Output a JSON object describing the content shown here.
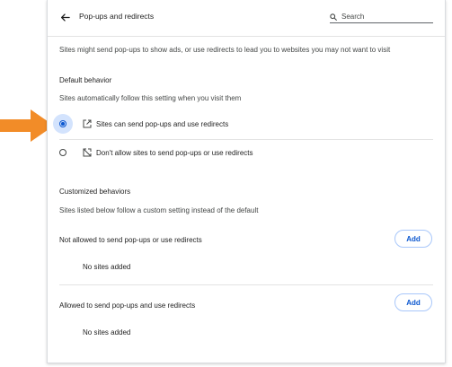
{
  "header": {
    "title": "Pop-ups and redirects",
    "search_placeholder": "Search"
  },
  "intro_text": "Sites might send pop-ups to show ads, or use redirects to lead you to websites you may not want to visit",
  "default_behavior": {
    "title": "Default behavior",
    "subtitle": "Sites automatically follow this setting when you visit them",
    "options": [
      {
        "label": "Sites can send pop-ups and use redirects",
        "selected": true,
        "icon": "open-in-new-icon"
      },
      {
        "label": "Don't allow sites to send pop-ups or use redirects",
        "selected": false,
        "icon": "popup-blocked-icon"
      }
    ]
  },
  "customized_behaviors": {
    "title": "Customized behaviors",
    "subtitle": "Sites listed below follow a custom setting instead of the default",
    "not_allowed": {
      "label": "Not allowed to send pop-ups or use redirects",
      "add_label": "Add",
      "empty_text": "No sites added"
    },
    "allowed": {
      "label": "Allowed to send pop-ups and use redirects",
      "add_label": "Add",
      "empty_text": "No sites added"
    }
  },
  "colors": {
    "accent": "#0b57d0",
    "arrow": "#f28c28",
    "radio_halo": "#d3e3fd"
  }
}
